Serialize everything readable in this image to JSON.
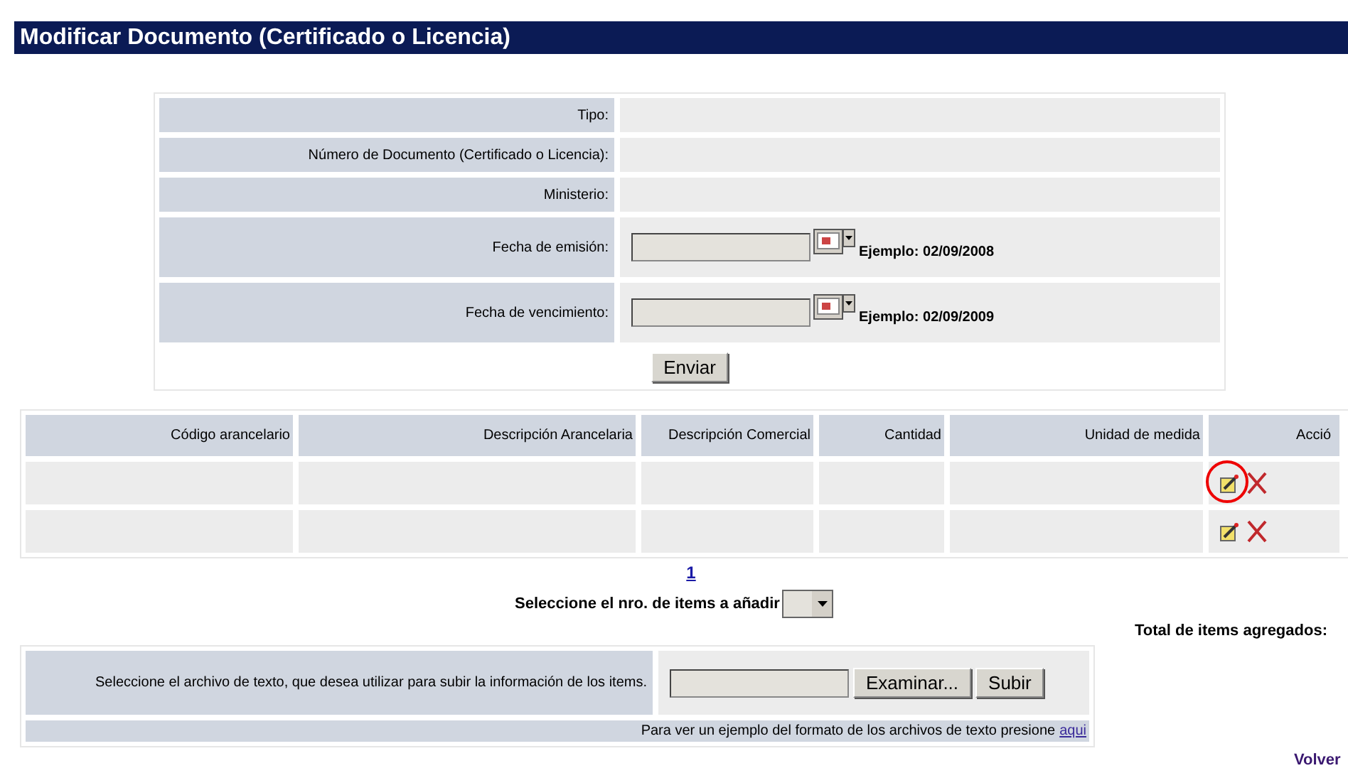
{
  "window": {
    "title": "Modificar Documento (Certificado o Licencia)"
  },
  "form": {
    "fields": [
      {
        "label": "Tipo:",
        "kind": "text"
      },
      {
        "label": "Número de Documento (Certificado o Licencia):",
        "kind": "text"
      },
      {
        "label": "Ministerio:",
        "kind": "text"
      },
      {
        "label": "Fecha de emisión:",
        "kind": "date",
        "example": "Ejemplo: 02/09/2008"
      },
      {
        "label": "Fecha de vencimiento:",
        "kind": "date",
        "example": "Ejemplo: 02/09/2009"
      }
    ],
    "submit": "Enviar"
  },
  "items_table": {
    "columns": [
      "Código arancelario",
      "Descripción Arancelaria",
      "Descripción Comercial",
      "Cantidad",
      "Unidad de medida",
      "Acció"
    ],
    "rows": [
      {
        "highlighted": true
      },
      {
        "highlighted": false
      }
    ]
  },
  "pagination": {
    "pages": [
      "1"
    ]
  },
  "add_items": {
    "label": "Seleccione el nro. de items a añadir"
  },
  "total_label": "Total de items agregados:",
  "upload": {
    "label": "Seleccione el archivo de texto, que desea utilizar para subir la información de los items.",
    "browse": "Examinar...",
    "submit": "Subir",
    "hint": "Para ver un ejemplo del formato de los archivos de texto presione",
    "link": "aqui"
  },
  "back_link": "Volver"
}
